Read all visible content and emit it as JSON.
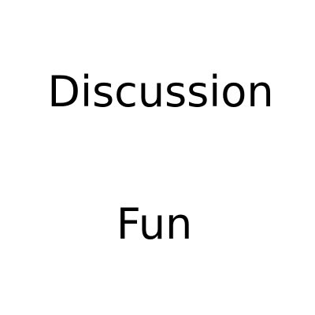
{
  "words": {
    "top": "Discussion",
    "bottom": "Fun"
  }
}
